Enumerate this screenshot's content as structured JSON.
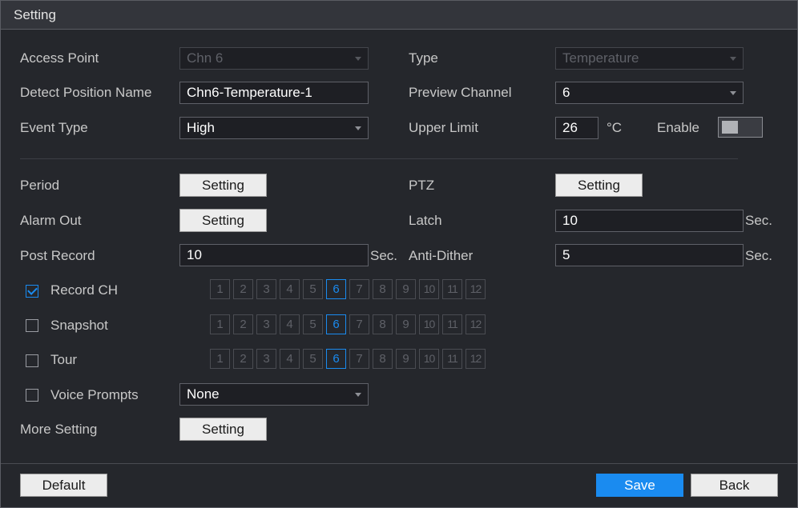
{
  "window": {
    "title": "Setting"
  },
  "form": {
    "access_point": {
      "label": "Access Point",
      "value": "Chn 6"
    },
    "type": {
      "label": "Type",
      "value": "Temperature"
    },
    "detect_position_name": {
      "label": "Detect Position Name",
      "value": "Chn6-Temperature-1"
    },
    "preview_channel": {
      "label": "Preview Channel",
      "value": "6"
    },
    "event_type": {
      "label": "Event Type",
      "value": "High"
    },
    "upper_limit": {
      "label": "Upper Limit",
      "value": "26",
      "unit": "°C"
    },
    "enable": {
      "label": "Enable",
      "on": false
    },
    "period": {
      "label": "Period",
      "button": "Setting"
    },
    "ptz": {
      "label": "PTZ",
      "button": "Setting"
    },
    "alarm_out": {
      "label": "Alarm Out",
      "button": "Setting"
    },
    "latch": {
      "label": "Latch",
      "value": "10",
      "unit": "Sec."
    },
    "post_record": {
      "label": "Post Record",
      "value": "10",
      "unit": "Sec."
    },
    "anti_dither": {
      "label": "Anti-Dither",
      "value": "5",
      "unit": "Sec."
    },
    "record_ch": {
      "label": "Record CH",
      "checked": true
    },
    "snapshot": {
      "label": "Snapshot",
      "checked": false
    },
    "tour": {
      "label": "Tour",
      "checked": false
    },
    "voice_prompts": {
      "label": "Voice Prompts",
      "checked": false,
      "value": "None"
    },
    "more_setting": {
      "label": "More Setting",
      "button": "Setting"
    }
  },
  "channels": {
    "labels": [
      "1",
      "2",
      "3",
      "4",
      "5",
      "6",
      "7",
      "8",
      "9",
      "10",
      "11",
      "12"
    ],
    "selected": "6"
  },
  "footer": {
    "default": "Default",
    "save": "Save",
    "back": "Back"
  },
  "colors": {
    "accent": "#1a8bf0",
    "background": "#25272c"
  }
}
